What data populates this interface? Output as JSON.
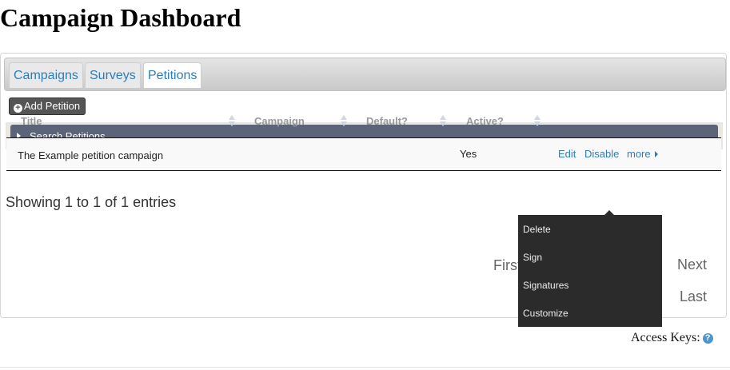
{
  "page": {
    "title": "Campaign Dashboard"
  },
  "tabs": [
    {
      "label": "Campaigns"
    },
    {
      "label": "Surveys"
    },
    {
      "label": "Petitions"
    }
  ],
  "toolbar": {
    "add_label": "Add Petition",
    "add_icon": "plus-circle-icon"
  },
  "search": {
    "label": "Search Petitions",
    "icon": "triangle-right-icon"
  },
  "table": {
    "columns": [
      "Title",
      "Campaign",
      "Default?",
      "Active?"
    ],
    "rows": [
      {
        "title": "The Example petition campaign",
        "campaign": "",
        "default": "",
        "active": "Yes",
        "actions": {
          "edit": "Edit",
          "disable": "Disable",
          "more": "more"
        }
      }
    ]
  },
  "info": "Showing 1 to 1 of 1 entries",
  "pagination": {
    "first": "First",
    "next": "Next",
    "last": "Last"
  },
  "more_menu": [
    "Delete",
    "Sign",
    "Signatures",
    "Customize"
  ],
  "footer": {
    "access_keys": "Access Keys:",
    "help_icon": "question-circle-icon"
  },
  "colors": {
    "link": "#2e7db7",
    "search_bar": "#5b6478",
    "menu_bg": "#2b2b2b",
    "button_bg": "#555555"
  }
}
